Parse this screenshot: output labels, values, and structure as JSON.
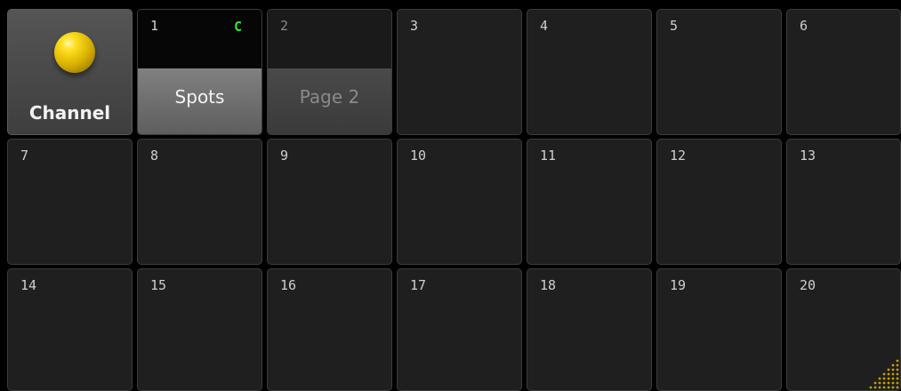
{
  "pool": {
    "title_cell": {
      "label": "Channel",
      "icon": "yellow-ball-icon"
    },
    "pages": [
      {
        "number": "1",
        "label": "Spots",
        "flag": "C",
        "state": "active"
      },
      {
        "number": "2",
        "label": "Page 2",
        "flag": "",
        "state": "inactive"
      }
    ],
    "empty_cells": [
      "3",
      "4",
      "5",
      "6",
      "7",
      "8",
      "9",
      "10",
      "11",
      "12",
      "13",
      "14",
      "15",
      "16",
      "17",
      "18",
      "19",
      "20"
    ],
    "colors": {
      "flag": "#2ee82e",
      "ball": "#ffd700",
      "cell_background": "#1f1f1f",
      "active_label_background": "#707070",
      "corner_grip": "#c8a000"
    },
    "corner_icon": "resize-grip-icon"
  }
}
